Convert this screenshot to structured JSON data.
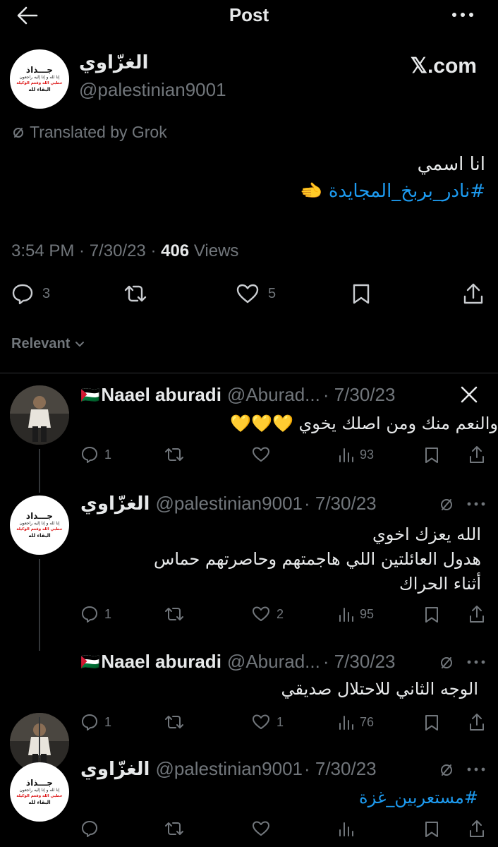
{
  "header": {
    "title": "Post"
  },
  "post": {
    "author_name": "الغزّاوي",
    "handle": "@palestinian9001",
    "source": "𝕏.com",
    "translated": "Translated by Grok",
    "text_line1": "انا اسمي",
    "hashtag": "#نادر_بربخ_المجايدة",
    "emoji": "🫲",
    "time": "3:54 PM · 7/30/23 · ",
    "views_count": "406",
    "views_label": " Views",
    "replies": "3",
    "likes": "5"
  },
  "logo": {
    "line1": "جـــذاذ",
    "line2": "إنا لله و إنا إليه راجعون",
    "line3": "حطبي الله وفعم الوكيلة",
    "line4": "البقاء لله"
  },
  "sort": {
    "label": "Relevant"
  },
  "replies": [
    {
      "author_name": "Naael aburadi",
      "flag": "🇵🇸",
      "handle": "@Aburad...",
      "date": "· 7/30/23",
      "text": "والنعم منك ومن اصلك يخوي",
      "emojis": "💛💛💛",
      "replies": "1",
      "likes": "",
      "views": "93"
    },
    {
      "author_name": "الغزّاوي",
      "handle": "@palestinian9001",
      "date": "· 7/30/23",
      "line1": "الله يعزك اخوي",
      "line2": "هدول العائلتين اللي هاجمتهم وحاصرتهم حماس",
      "line3": "أثناء الحراك",
      "replies": "1",
      "likes": "2",
      "views": "95"
    },
    {
      "author_name": "Naael aburadi",
      "flag": "🇵🇸",
      "handle": "@Aburad...",
      "date": "· 7/30/23",
      "text": "الوجه الثاني للاحتلال صديقي",
      "replies": "1",
      "likes": "1",
      "views": "76"
    },
    {
      "author_name": "الغزّاوي",
      "handle": "@palestinian9001",
      "date": "· 7/30/23",
      "hashtag": "#مستعربين_غزة"
    }
  ],
  "colors": {
    "background": "#000000",
    "text": "#e7e9ea",
    "muted": "#71767b",
    "link": "#1d9bf0",
    "divider": "#2f3336"
  }
}
